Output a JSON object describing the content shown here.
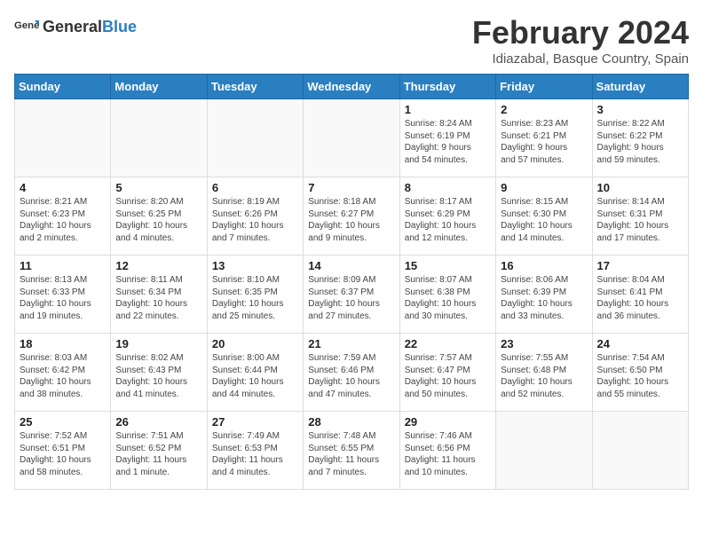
{
  "header": {
    "logo_general": "General",
    "logo_blue": "Blue",
    "title": "February 2024",
    "subtitle": "Idiazabal, Basque Country, Spain"
  },
  "days_of_week": [
    "Sunday",
    "Monday",
    "Tuesday",
    "Wednesday",
    "Thursday",
    "Friday",
    "Saturday"
  ],
  "weeks": [
    [
      {
        "day": "",
        "info": ""
      },
      {
        "day": "",
        "info": ""
      },
      {
        "day": "",
        "info": ""
      },
      {
        "day": "",
        "info": ""
      },
      {
        "day": "1",
        "info": "Sunrise: 8:24 AM\nSunset: 6:19 PM\nDaylight: 9 hours\nand 54 minutes."
      },
      {
        "day": "2",
        "info": "Sunrise: 8:23 AM\nSunset: 6:21 PM\nDaylight: 9 hours\nand 57 minutes."
      },
      {
        "day": "3",
        "info": "Sunrise: 8:22 AM\nSunset: 6:22 PM\nDaylight: 9 hours\nand 59 minutes."
      }
    ],
    [
      {
        "day": "4",
        "info": "Sunrise: 8:21 AM\nSunset: 6:23 PM\nDaylight: 10 hours\nand 2 minutes."
      },
      {
        "day": "5",
        "info": "Sunrise: 8:20 AM\nSunset: 6:25 PM\nDaylight: 10 hours\nand 4 minutes."
      },
      {
        "day": "6",
        "info": "Sunrise: 8:19 AM\nSunset: 6:26 PM\nDaylight: 10 hours\nand 7 minutes."
      },
      {
        "day": "7",
        "info": "Sunrise: 8:18 AM\nSunset: 6:27 PM\nDaylight: 10 hours\nand 9 minutes."
      },
      {
        "day": "8",
        "info": "Sunrise: 8:17 AM\nSunset: 6:29 PM\nDaylight: 10 hours\nand 12 minutes."
      },
      {
        "day": "9",
        "info": "Sunrise: 8:15 AM\nSunset: 6:30 PM\nDaylight: 10 hours\nand 14 minutes."
      },
      {
        "day": "10",
        "info": "Sunrise: 8:14 AM\nSunset: 6:31 PM\nDaylight: 10 hours\nand 17 minutes."
      }
    ],
    [
      {
        "day": "11",
        "info": "Sunrise: 8:13 AM\nSunset: 6:33 PM\nDaylight: 10 hours\nand 19 minutes."
      },
      {
        "day": "12",
        "info": "Sunrise: 8:11 AM\nSunset: 6:34 PM\nDaylight: 10 hours\nand 22 minutes."
      },
      {
        "day": "13",
        "info": "Sunrise: 8:10 AM\nSunset: 6:35 PM\nDaylight: 10 hours\nand 25 minutes."
      },
      {
        "day": "14",
        "info": "Sunrise: 8:09 AM\nSunset: 6:37 PM\nDaylight: 10 hours\nand 27 minutes."
      },
      {
        "day": "15",
        "info": "Sunrise: 8:07 AM\nSunset: 6:38 PM\nDaylight: 10 hours\nand 30 minutes."
      },
      {
        "day": "16",
        "info": "Sunrise: 8:06 AM\nSunset: 6:39 PM\nDaylight: 10 hours\nand 33 minutes."
      },
      {
        "day": "17",
        "info": "Sunrise: 8:04 AM\nSunset: 6:41 PM\nDaylight: 10 hours\nand 36 minutes."
      }
    ],
    [
      {
        "day": "18",
        "info": "Sunrise: 8:03 AM\nSunset: 6:42 PM\nDaylight: 10 hours\nand 38 minutes."
      },
      {
        "day": "19",
        "info": "Sunrise: 8:02 AM\nSunset: 6:43 PM\nDaylight: 10 hours\nand 41 minutes."
      },
      {
        "day": "20",
        "info": "Sunrise: 8:00 AM\nSunset: 6:44 PM\nDaylight: 10 hours\nand 44 minutes."
      },
      {
        "day": "21",
        "info": "Sunrise: 7:59 AM\nSunset: 6:46 PM\nDaylight: 10 hours\nand 47 minutes."
      },
      {
        "day": "22",
        "info": "Sunrise: 7:57 AM\nSunset: 6:47 PM\nDaylight: 10 hours\nand 50 minutes."
      },
      {
        "day": "23",
        "info": "Sunrise: 7:55 AM\nSunset: 6:48 PM\nDaylight: 10 hours\nand 52 minutes."
      },
      {
        "day": "24",
        "info": "Sunrise: 7:54 AM\nSunset: 6:50 PM\nDaylight: 10 hours\nand 55 minutes."
      }
    ],
    [
      {
        "day": "25",
        "info": "Sunrise: 7:52 AM\nSunset: 6:51 PM\nDaylight: 10 hours\nand 58 minutes."
      },
      {
        "day": "26",
        "info": "Sunrise: 7:51 AM\nSunset: 6:52 PM\nDaylight: 11 hours\nand 1 minute."
      },
      {
        "day": "27",
        "info": "Sunrise: 7:49 AM\nSunset: 6:53 PM\nDaylight: 11 hours\nand 4 minutes."
      },
      {
        "day": "28",
        "info": "Sunrise: 7:48 AM\nSunset: 6:55 PM\nDaylight: 11 hours\nand 7 minutes."
      },
      {
        "day": "29",
        "info": "Sunrise: 7:46 AM\nSunset: 6:56 PM\nDaylight: 11 hours\nand 10 minutes."
      },
      {
        "day": "",
        "info": ""
      },
      {
        "day": "",
        "info": ""
      }
    ]
  ]
}
